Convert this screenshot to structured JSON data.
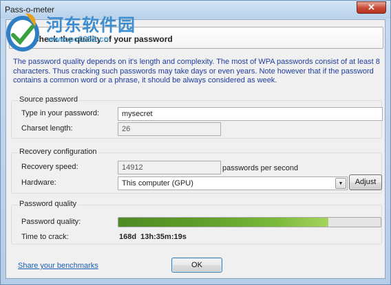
{
  "window": {
    "title": "Pass-o-meter",
    "close_glyph": "✕",
    "watermark_text": "河东软件园",
    "watermark_url": "www.pc0359.cn"
  },
  "header": {
    "title": "Check the quality of your password",
    "icon": "check-icon"
  },
  "description": "The password quality depends on it's length and complexity. The most of WPA passwords consist of at least 8 characters. Thus cracking such passwords may take days or even years. Note however that if the password contains a common word or a phrase, it should be always considered as week.",
  "source": {
    "title": "Source password",
    "password_label": "Type in your password:",
    "password_value": "mysecret",
    "charset_label": "Charset length:",
    "charset_value": "26"
  },
  "recovery": {
    "title": "Recovery configuration",
    "speed_label": "Recovery speed:",
    "speed_value": "14912",
    "speed_unit": "passwords per second",
    "hardware_label": "Hardware:",
    "hardware_value": "This computer (GPU)",
    "adjust_label": "Adjust"
  },
  "quality": {
    "title": "Password quality",
    "quality_label": "Password quality:",
    "quality_level": 0.8,
    "time_label": "Time to crack:",
    "time_value": "168d  13h:35m:19s"
  },
  "footer": {
    "share_link": "Share your benchmarks",
    "ok_label": "OK"
  },
  "colors": {
    "description_text": "#1f3c9c",
    "progress_green": "#5e9e2a",
    "link": "#1a5fb4"
  }
}
